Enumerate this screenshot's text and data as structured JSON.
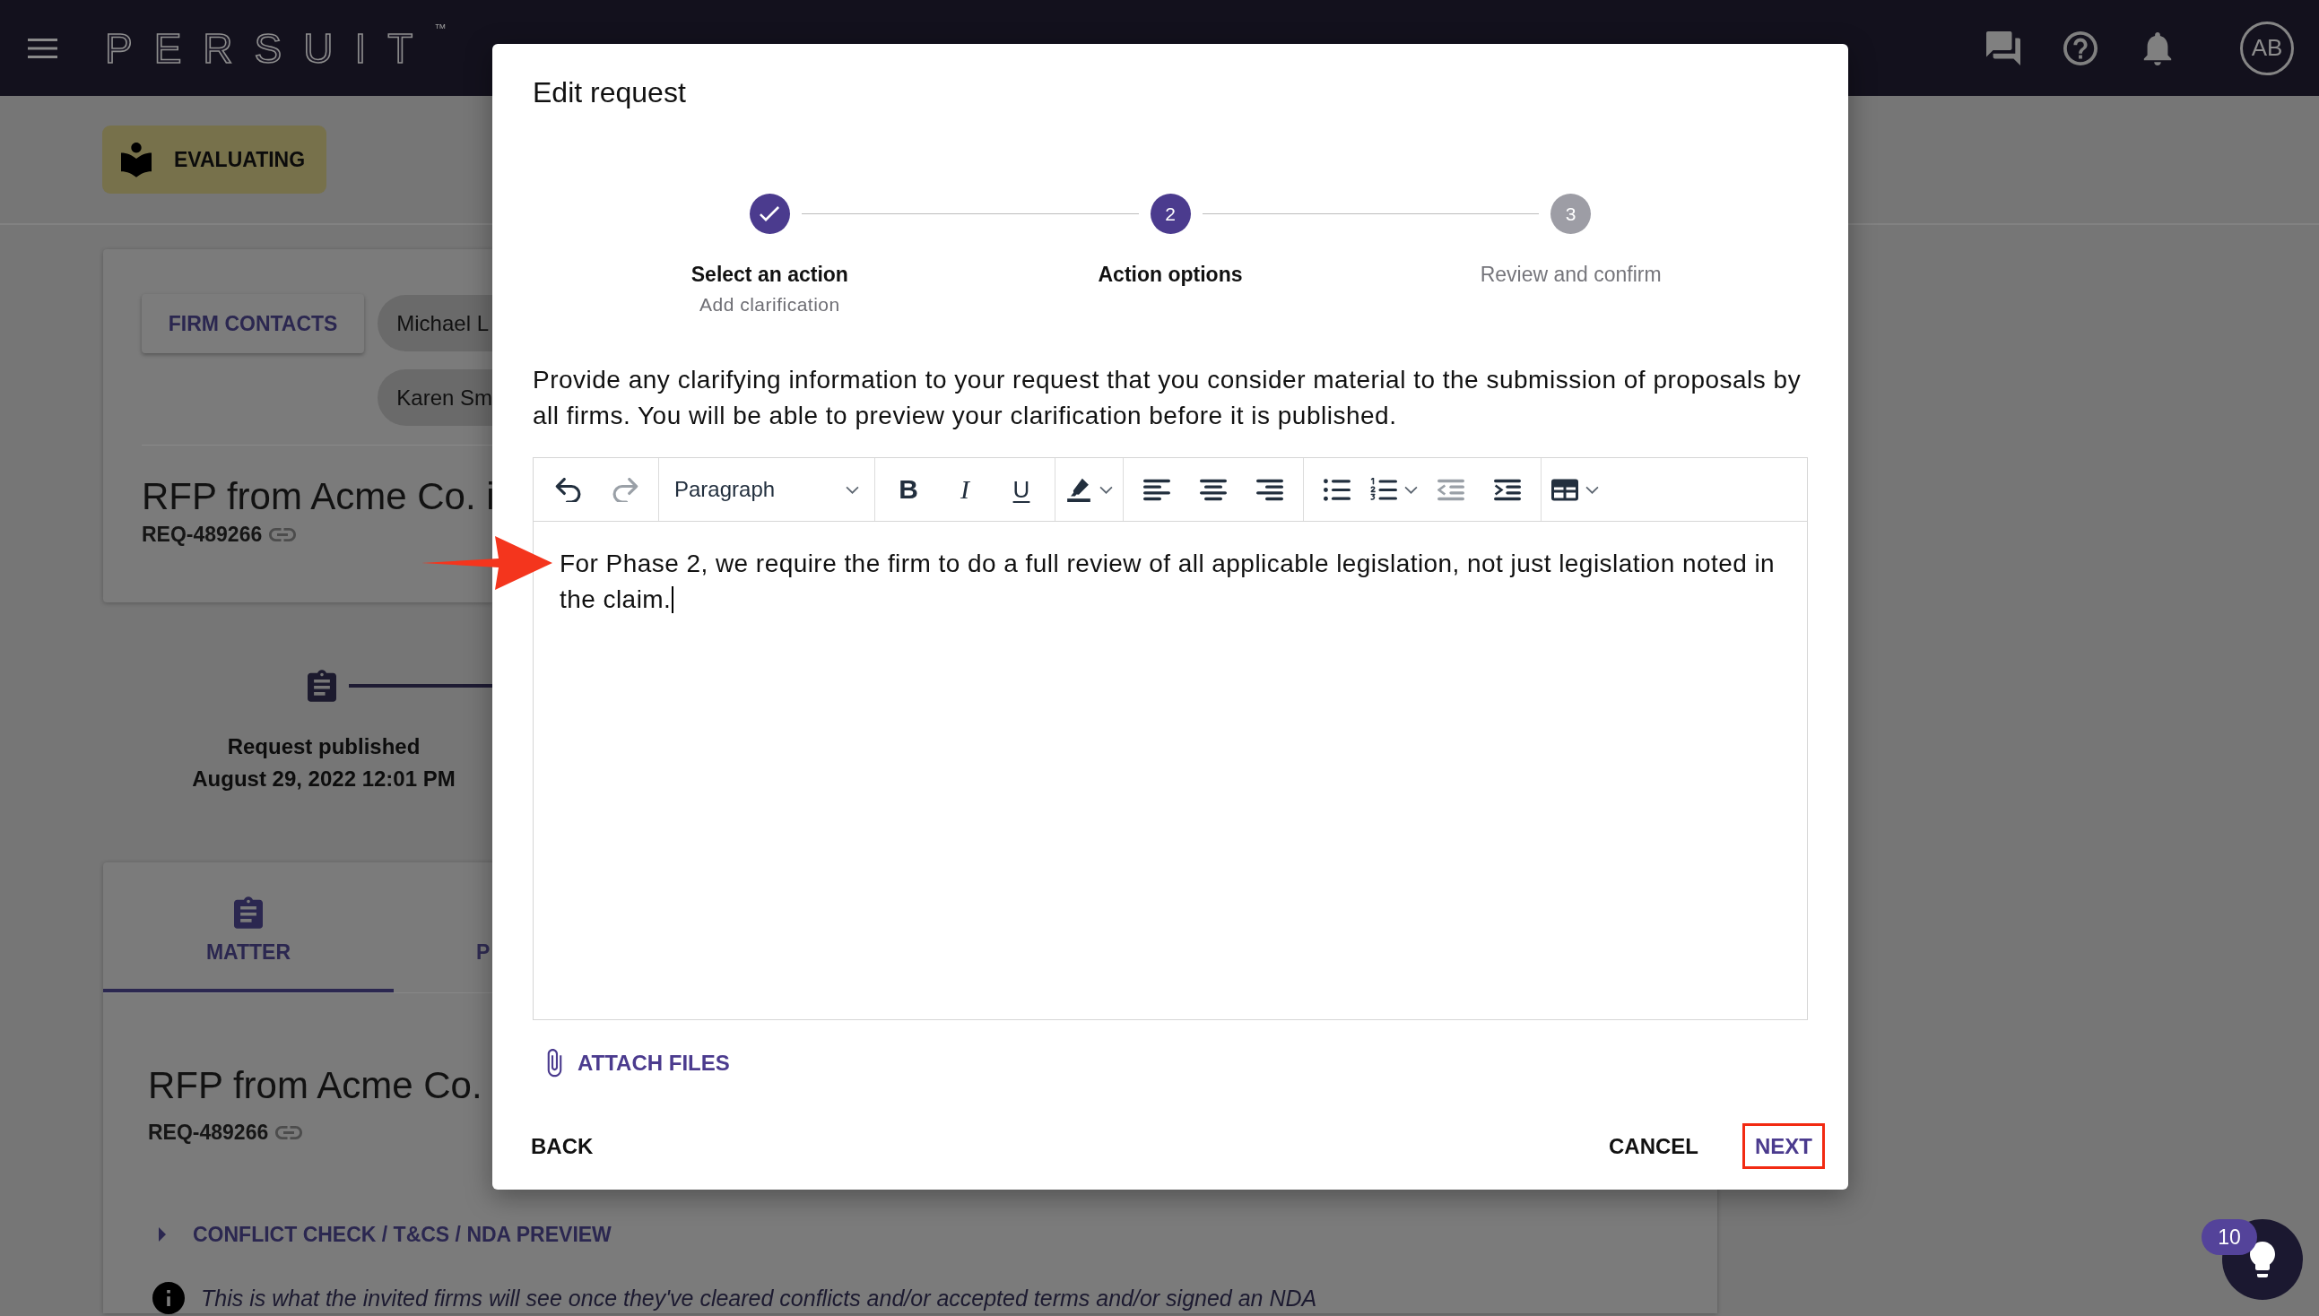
{
  "top_bar": {
    "logo": "PERSUIT$^{™}$",
    "avatar": "AB"
  },
  "background": {
    "status_badge": "EVALUATING",
    "summary_card": {
      "contacts_button": "FIRM CONTACTS",
      "contacts": [
        "Michael L",
        "Karen Sm"
      ],
      "title": "RFP from Acme Co. i",
      "request_id": "REQ-489266"
    },
    "timeline": {
      "event": "Request published",
      "date": "August 29, 2022 12:01 PM"
    },
    "details_card": {
      "tabs": [
        {
          "label": "MATTER",
          "selected": true
        },
        {
          "label": "P",
          "selected": false
        }
      ],
      "title": "RFP from Acme Co.",
      "request_id": "REQ-489266",
      "section": {
        "label": "CONFLICT CHECK / T&CS / NDA PREVIEW",
        "expanded": false
      },
      "note": "This is what the invited firms will see once they've cleared conflicts and/or accepted terms and/or signed an NDA"
    }
  },
  "dialog": {
    "title": "Edit request",
    "steps": [
      {
        "kind": "completed",
        "label": "Select an action",
        "detail": "Add clarification"
      },
      {
        "kind": "current",
        "label": "Action options",
        "number": "2"
      },
      {
        "kind": "upcoming",
        "label": "Review and confirm",
        "number": "3"
      }
    ],
    "instructions": "Provide any clarifying information to your request that you consider material to the submission of proposals by all firms. You will be able to preview your clarification before it is published.",
    "editor": {
      "toolbar": [
        [
          {
            "kind": "undo",
            "disabled": false,
            "menu": false
          },
          {
            "kind": "redo",
            "disabled": true,
            "menu": false
          }
        ],
        [
          {
            "kind": "block_format",
            "value": "Paragraph",
            "disabled": false,
            "menu": true
          }
        ],
        [
          {
            "kind": "bold",
            "label": "B",
            "disabled": false,
            "menu": false
          },
          {
            "kind": "italic",
            "label": "I",
            "disabled": false,
            "menu": false
          },
          {
            "kind": "underline",
            "label": "U",
            "disabled": false,
            "menu": false
          }
        ],
        [
          {
            "kind": "highlight",
            "disabled": false,
            "menu": true
          }
        ],
        [
          {
            "kind": "align_left",
            "disabled": false,
            "menu": false
          },
          {
            "kind": "align_center",
            "disabled": false,
            "menu": false
          },
          {
            "kind": "align_right",
            "disabled": false,
            "menu": false
          }
        ],
        [
          {
            "kind": "bullet_list",
            "disabled": false,
            "menu": false
          },
          {
            "kind": "numbered_list",
            "disabled": false,
            "menu": true
          },
          {
            "kind": "outdent",
            "disabled": true,
            "menu": false
          },
          {
            "kind": "indent",
            "disabled": false,
            "menu": false
          }
        ],
        [
          {
            "kind": "table",
            "disabled": false,
            "menu": true
          }
        ]
      ],
      "value": "For Phase 2, we require the firm to do a full review of all applicable legislation, not just legislation noted in the claim.",
      "focused": true
    },
    "attach": "ATTACH FILES",
    "footer": {
      "back": "BACK",
      "actions": [
        {
          "label": "CANCEL",
          "primary": false,
          "highlighted": false
        },
        {
          "label": "NEXT",
          "primary": true,
          "highlighted": true
        }
      ]
    }
  },
  "help_widget": {
    "badge": "10"
  }
}
